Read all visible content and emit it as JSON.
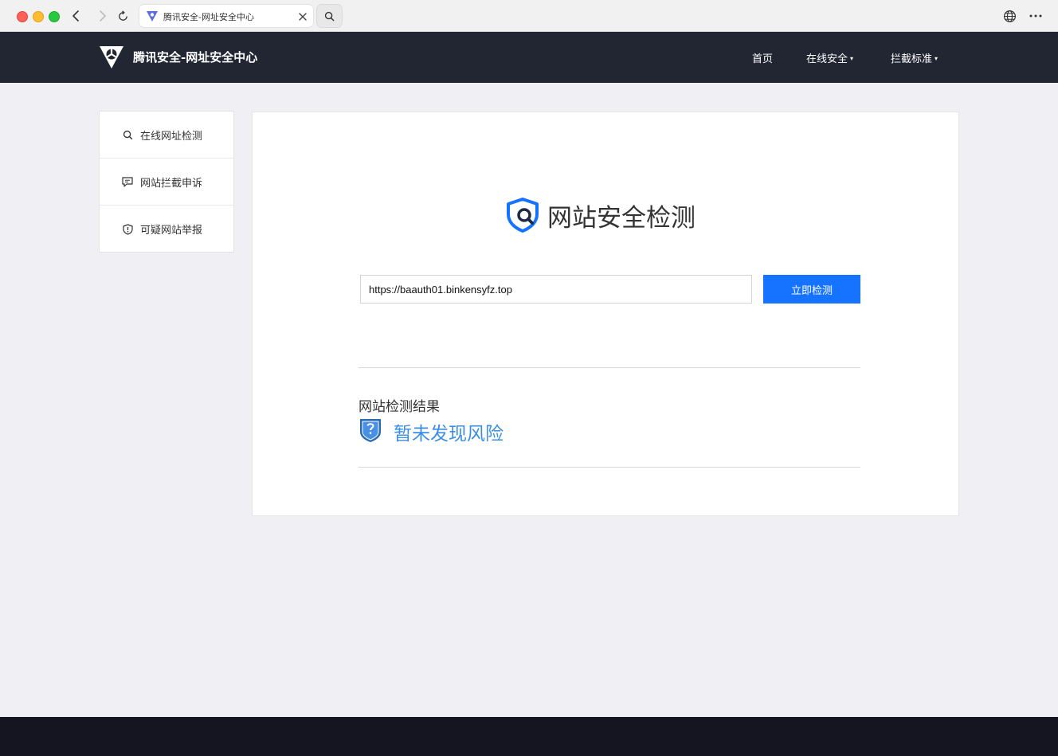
{
  "browser": {
    "tab_title": "腾讯安全-网址安全中心",
    "icons": [
      "back-icon",
      "forward-icon",
      "reload-icon",
      "close-icon",
      "search-icon",
      "globe-icon",
      "more-icon"
    ]
  },
  "header": {
    "brand": "腾讯安全-网址安全中心",
    "nav": [
      {
        "label": "首页"
      },
      {
        "label": "在线安全",
        "caret": "▾"
      },
      {
        "label": "拦截标准",
        "caret": "▾"
      }
    ]
  },
  "sidebar": {
    "items": [
      {
        "label": "在线网址检测",
        "icon": "search-icon"
      },
      {
        "label": "网站拦截申诉",
        "icon": "message-icon"
      },
      {
        "label": "可疑网站举报",
        "icon": "shield-alert-icon"
      }
    ]
  },
  "main": {
    "title": "网站安全检测",
    "url_value": "https://baauth01.binkensyfz.top",
    "check_button": "立即检测",
    "result_heading": "网站检测结果",
    "result_status": "暂未发现风险"
  },
  "colors": {
    "header_bg": "#222633",
    "accent": "#1673ff",
    "result_text": "#3a8ee6",
    "page_bg": "#efeff4",
    "footer_bg": "#141521"
  }
}
